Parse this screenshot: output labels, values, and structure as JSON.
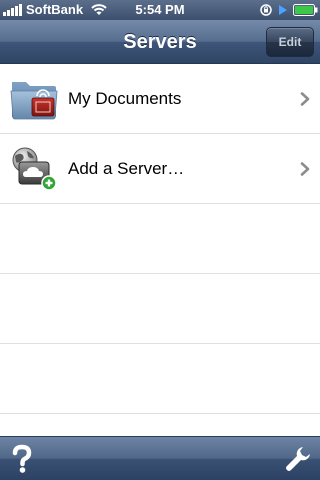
{
  "status_bar": {
    "carrier": "SoftBank",
    "time": "5:54 PM",
    "icons": [
      "signal-bars-icon",
      "wifi-icon",
      "orientation-lock-icon",
      "play-icon",
      "battery-icon"
    ]
  },
  "nav_bar": {
    "title": "Servers",
    "edit_label": "Edit"
  },
  "servers": {
    "items": [
      {
        "label": "My Documents",
        "icon": "documents-folder-icon"
      },
      {
        "label": "Add a Server…",
        "icon": "add-server-icon"
      }
    ]
  },
  "toolbar": {
    "icons": [
      "help-icon",
      "wrench-icon"
    ]
  },
  "colors": {
    "bar_blue": "#4a6285",
    "battery_green": "#3ec84a",
    "add_badge_green": "#2fa536",
    "chevron": "#8c8c8c"
  }
}
